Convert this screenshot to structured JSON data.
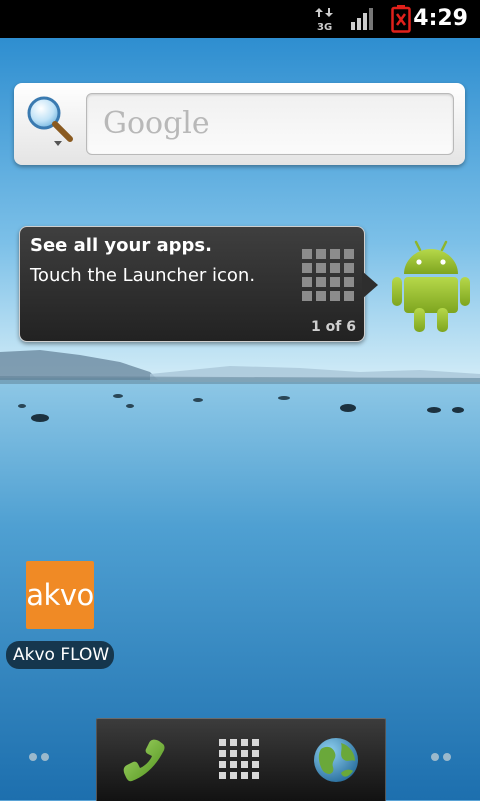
{
  "status_bar": {
    "network_type": "3G",
    "time": "4:29"
  },
  "search_widget": {
    "placeholder": "Google"
  },
  "tutorial": {
    "title": "See all your apps.",
    "body": "Touch the Launcher icon.",
    "page_indicator": "1 of 6"
  },
  "shortcuts": [
    {
      "icon_text": "akvo",
      "label": "Akvo FLOW",
      "color": "#f08a25"
    }
  ],
  "dock": {
    "items": [
      {
        "name": "phone-icon"
      },
      {
        "name": "launcher-grid-icon"
      },
      {
        "name": "browser-globe-icon"
      }
    ]
  },
  "icons": {
    "status": [
      "3g-data-icon",
      "signal-strength-icon",
      "battery-alert-icon"
    ],
    "widget": [
      "search-magnifier-icon"
    ],
    "tutorial": [
      "launcher-grid-icon",
      "android-robot-icon"
    ],
    "workspace": [
      "workspace-left-dots-icon",
      "workspace-right-dots-icon"
    ]
  },
  "colors": {
    "status_bar": "#000000",
    "battery_alert": "#e0201b",
    "accent_orange": "#f08a25",
    "android_green": "#a4c639"
  }
}
